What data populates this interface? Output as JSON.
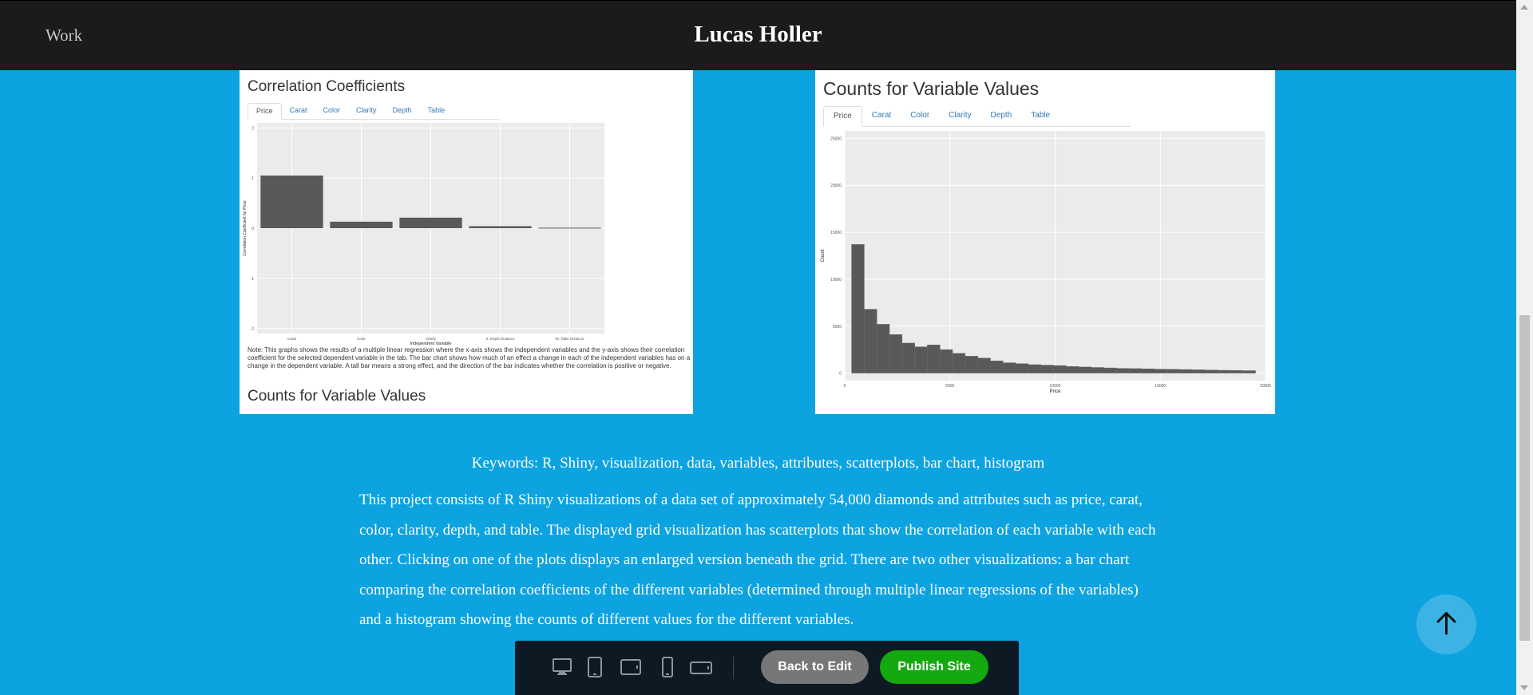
{
  "header": {
    "nav_work": "Work",
    "site_title": "Lucas Holler"
  },
  "left_screenshot": {
    "title": "Correlation Coefficients",
    "tabs": [
      "Price",
      "Carat",
      "Color",
      "Clarity",
      "Depth",
      "Table"
    ],
    "active_tab": "Price",
    "note": "Note: This graphs shows the results of a multiple linear regression where the x-axis shows the independent variables and the y-axis shows their correlation coefficient for the selected dependent variable in the tab. The bar chart shows how much of an effect a change in each of the independent variables has on a change in the dependent variable. A tall bar means a strong effect, and the direction of the bar indicates whether the correlation is positive or negative.",
    "bottom_title": "Counts for Variable Values"
  },
  "right_screenshot": {
    "title": "Counts for Variable Values",
    "tabs": [
      "Price",
      "Carat",
      "Color",
      "Clarity",
      "Depth",
      "Table"
    ],
    "active_tab": "Price"
  },
  "chart_data": [
    {
      "type": "bar",
      "xlabel": "Independent Variable",
      "ylabel": "Correlation Coefficient for Price",
      "categories": [
        "Carat",
        "Color",
        "Clarity",
        "X, Depth Distance",
        "W, Table Distance"
      ],
      "values": [
        1.05,
        0.13,
        0.21,
        0.04,
        0.01
      ],
      "ylim": [
        -2.1,
        2.1
      ],
      "yticks": [
        "-2",
        "-1",
        "0",
        "1",
        "2"
      ],
      "grid": true
    },
    {
      "type": "bar",
      "xlabel": "Price",
      "ylabel": "Count",
      "bin_start": 326,
      "bin_width": 600,
      "values": [
        13700,
        6800,
        5200,
        4100,
        3200,
        2800,
        3000,
        2500,
        2100,
        1800,
        1600,
        1300,
        1100,
        1000,
        900,
        850,
        800,
        700,
        650,
        600,
        550,
        500,
        480,
        450,
        420,
        400,
        380,
        350,
        320,
        300,
        280,
        260
      ],
      "xlim": [
        0,
        20000
      ],
      "ylim": [
        -800,
        25800
      ],
      "xticks": [
        "0",
        "5000",
        "10000",
        "15000",
        "20000"
      ],
      "yticks": [
        "0",
        "5000",
        "10000",
        "15000",
        "20000",
        "25000"
      ],
      "grid": true
    }
  ],
  "keywords": "Keywords: R, Shiny, visualization, data, variables, attributes, scatterplots, bar chart, histogram",
  "description": "This project consists of R Shiny visualizations of a data set of approximately 54,000 diamonds and attributes such as price, carat, color, clarity, depth, and table. The displayed grid visualization has scatterplots that show the correlation of each variable with each other. Clicking on one of the plots displays an enlarged version beneath the grid. There are two other visualizations: a bar chart comparing the correlation coefficients of the different variables (determined through multiple linear regressions of the variables) and a histogram showing the counts of different values for the different variables.",
  "toolbar": {
    "devices": [
      "desktop-icon",
      "tablet-portrait-icon",
      "tablet-landscape-icon",
      "phone-portrait-icon",
      "phone-landscape-icon"
    ],
    "back_label": "Back to Edit",
    "publish_label": "Publish Site"
  },
  "colors": {
    "page_bg": "#0ca3e0",
    "header_bg": "#1b1b1b",
    "publish_green": "#13a90f",
    "back_gray": "#777777"
  }
}
